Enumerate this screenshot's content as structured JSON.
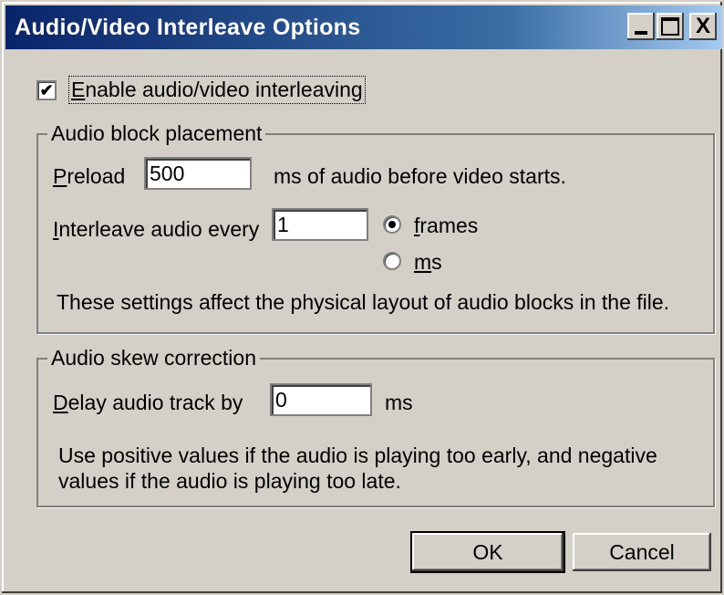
{
  "window": {
    "title": "Audio/Video Interleave Options",
    "controls": {
      "minimize_icon": "minimize-icon",
      "maximize_icon": "maximize-icon",
      "close_label": "X"
    }
  },
  "enable_interleave": {
    "label_first": "E",
    "label_rest": "nable audio/video interleaving",
    "checked": true
  },
  "audio_block": {
    "legend": "Audio block placement",
    "preload_label_first": "P",
    "preload_label_rest": "reload",
    "preload_value": "500",
    "preload_suffix": "ms of audio before video starts.",
    "interleave_label_first": "I",
    "interleave_label_rest": "nterleave audio every",
    "interleave_value": "1",
    "unit_frames_first": "f",
    "unit_frames_rest": "rames",
    "unit_ms_first": "m",
    "unit_ms_rest": "s",
    "selected_unit": "frames",
    "note": "These settings affect the physical layout of audio blocks in the file."
  },
  "skew": {
    "legend": "Audio skew correction",
    "delay_label_first": "D",
    "delay_label_rest": "elay audio track by",
    "delay_value": "0",
    "delay_suffix": "ms",
    "note_line1": "Use positive values if the audio is playing too early, and negative",
    "note_line2": "values if the audio is playing too late."
  },
  "buttons": {
    "ok": "OK",
    "cancel": "Cancel"
  }
}
